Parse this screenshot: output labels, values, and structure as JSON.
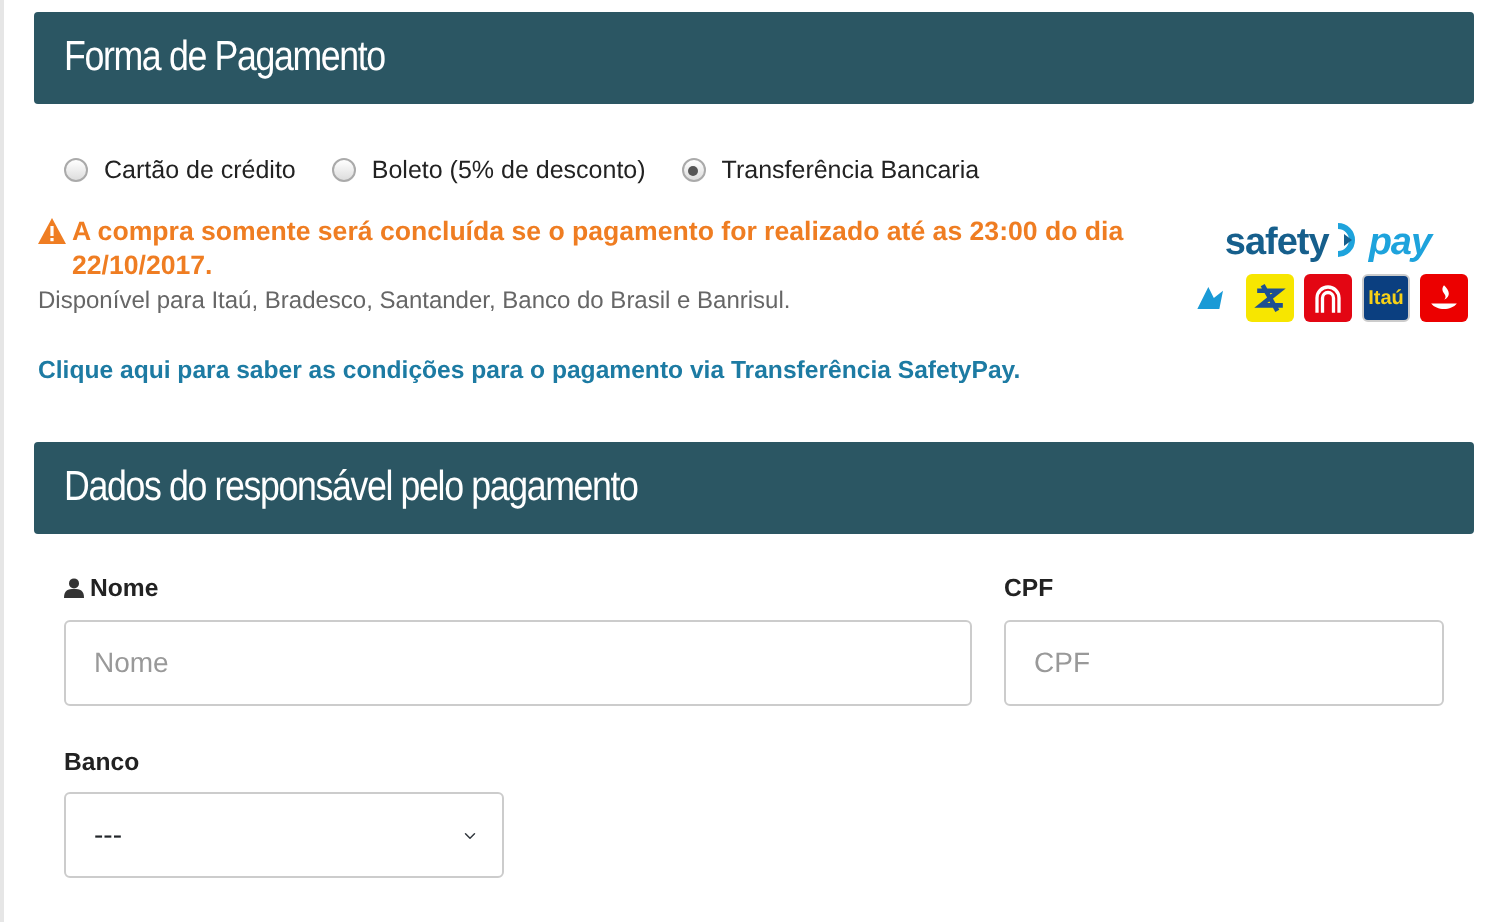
{
  "payment_section": {
    "title": "Forma de Pagamento",
    "methods": [
      {
        "label": "Cartão de crédito",
        "selected": false
      },
      {
        "label": "Boleto (5% de desconto)",
        "selected": false
      },
      {
        "label": "Transferência Bancaria",
        "selected": true
      }
    ],
    "warning": "A compra somente será concluída se o pagamento for realizado até as 23:00 do dia 22/10/2017.",
    "availability": "Disponível para Itaú, Bradesco, Santander, Banco do Brasil e Banrisul.",
    "conditions_link": "Clique aqui para saber as condições para o pagamento via Transferência SafetyPay.",
    "logo": {
      "word_1": "safety",
      "word_2": "pay"
    },
    "banks": [
      {
        "kind": "bradesco",
        "color": "#ffffff"
      },
      {
        "kind": "bb",
        "color": "#f7e600"
      },
      {
        "kind": "banrisul",
        "color": "#e30613"
      },
      {
        "kind": "itau",
        "color": "#0b3f80",
        "label": "Itaú"
      },
      {
        "kind": "santander",
        "color": "#ec0000"
      }
    ]
  },
  "payer_section": {
    "title": "Dados do responsável pelo pagamento",
    "fields": [
      {
        "label": "Nome",
        "placeholder": "Nome",
        "kind": "text",
        "icon": true
      },
      {
        "label": "CPF",
        "placeholder": "CPF",
        "kind": "text",
        "icon": false
      },
      {
        "label": "Banco",
        "value": "---",
        "kind": "select",
        "icon": false
      }
    ]
  }
}
